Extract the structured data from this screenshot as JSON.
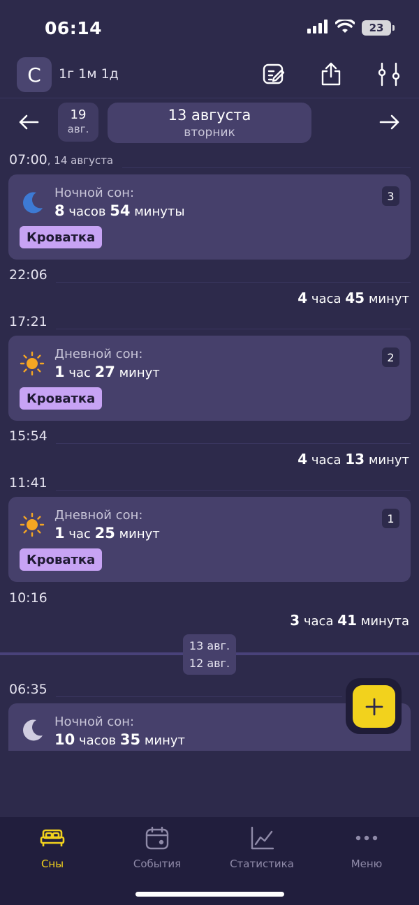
{
  "status_bar": {
    "time": "06:14",
    "battery": "23"
  },
  "header": {
    "avatar_letter": "С",
    "age": "1г 1м 1д",
    "icons": [
      "edit-icon",
      "share-icon",
      "filters-icon"
    ]
  },
  "date_nav": {
    "prev_day": "19",
    "prev_month": "авг.",
    "current_date": "13 августа",
    "current_weekday": "вторник"
  },
  "timeline": {
    "t1_time": "07:00",
    "t1_sub": ", 14 августа",
    "card1": {
      "label": "Ночной сон:",
      "h": "8",
      "h_unit": " часов ",
      "m": "54",
      "m_unit": " минуты",
      "number": "3",
      "tag": "Кроватка",
      "icon": "moon-icon"
    },
    "t2_time": "22:06",
    "awake1": {
      "h": "4",
      "h_unit": " часа ",
      "m": "45",
      "m_unit": " минут"
    },
    "t3_time": "17:21",
    "card2": {
      "label": "Дневной сон:",
      "h": "1",
      "h_unit": " час ",
      "m": "27",
      "m_unit": " минут",
      "number": "2",
      "tag": "Кроватка",
      "icon": "sun-icon"
    },
    "t4_time": "15:54",
    "awake2": {
      "h": "4",
      "h_unit": " часа ",
      "m": "13",
      "m_unit": " минут"
    },
    "t5_time": "11:41",
    "card3": {
      "label": "Дневной сон:",
      "h": "1",
      "h_unit": " час ",
      "m": "25",
      "m_unit": " минут",
      "number": "1",
      "tag": "Кроватка",
      "icon": "sun-icon"
    },
    "t6_time": "10:16",
    "awake3": {
      "h": "3",
      "h_unit": " часа ",
      "m": "41",
      "m_unit": " минута"
    },
    "day_sep_top": "13 авг.",
    "day_sep_bottom": "12 авг.",
    "t7_time": "06:35",
    "card4": {
      "label": "Ночной сон:",
      "h": "10",
      "h_unit": " часов ",
      "m": "35",
      "m_unit": " минут",
      "icon": "moon-icon"
    }
  },
  "tabs": [
    {
      "label": "Сны",
      "icon": "bed-icon",
      "active": true
    },
    {
      "label": "События",
      "icon": "calendar-icon",
      "active": false
    },
    {
      "label": "Статистика",
      "icon": "chart-icon",
      "active": false
    },
    {
      "label": "Меню",
      "icon": "more-icon",
      "active": false
    }
  ],
  "colors": {
    "background": "#2d2a4b",
    "card": "#46406b",
    "tag": "#c7a3f4",
    "accent": "#f2d21d",
    "tabbar": "#211e3d"
  }
}
